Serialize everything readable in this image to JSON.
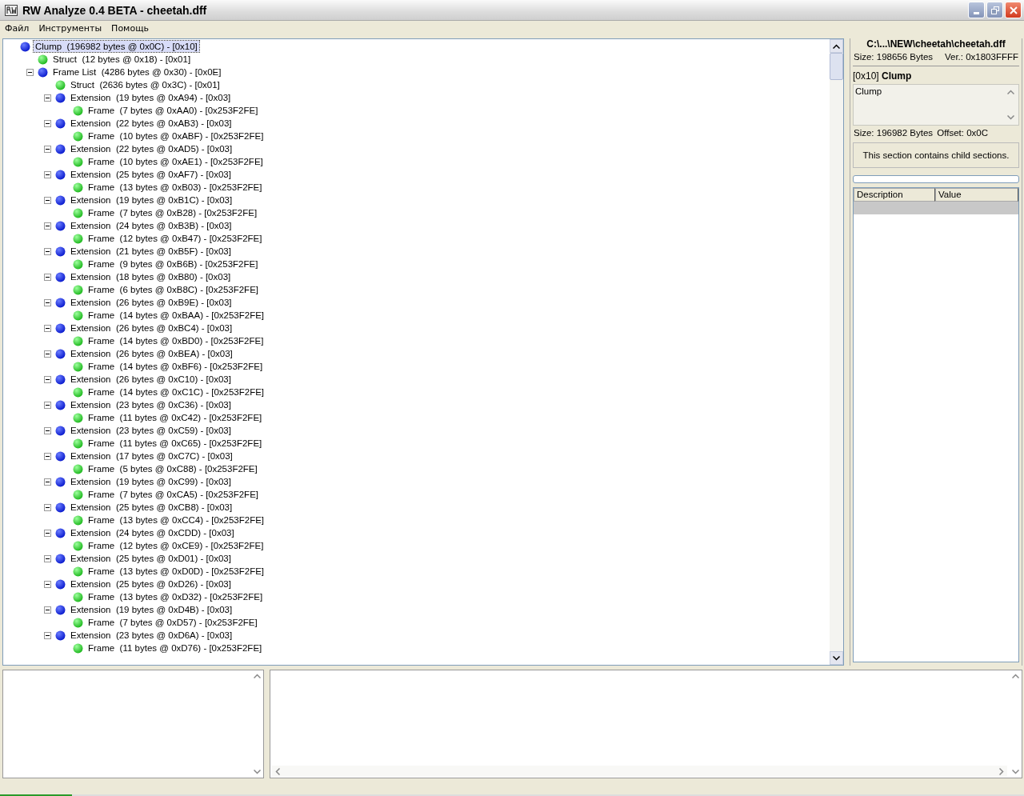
{
  "window": {
    "title": "RW Analyze 0.4 BETA - cheetah.dff"
  },
  "menu": [
    "Файл",
    "Инструменты",
    "Помощь"
  ],
  "tree": [
    {
      "label": "Clump  (196982 bytes @ 0x0C) - [0x10]",
      "kind": "container",
      "selected": true,
      "children": [
        {
          "label": "Struct  (12 bytes @ 0x18) - [0x01]",
          "kind": "data",
          "selected": false
        },
        {
          "label": "Frame List  (4286 bytes @ 0x30) - [0x0E]",
          "kind": "container",
          "selected": false,
          "expanded": true,
          "children": [
            {
              "label": "Struct  (2636 bytes @ 0x3C) - [0x01]",
              "kind": "data",
              "selected": false
            },
            {
              "label": "Extension  (19 bytes @ 0xA94) - [0x03]",
              "kind": "container",
              "selected": false,
              "expanded": true,
              "children": [
                {
                  "label": "Frame  (7 bytes @ 0xAA0) - [0x253F2FE]",
                  "kind": "data",
                  "selected": false
                }
              ]
            },
            {
              "label": "Extension  (22 bytes @ 0xAB3) - [0x03]",
              "kind": "container",
              "selected": false,
              "expanded": true,
              "children": [
                {
                  "label": "Frame  (10 bytes @ 0xABF) - [0x253F2FE]",
                  "kind": "data",
                  "selected": false
                }
              ]
            },
            {
              "label": "Extension  (22 bytes @ 0xAD5) - [0x03]",
              "kind": "container",
              "selected": false,
              "expanded": true,
              "children": [
                {
                  "label": "Frame  (10 bytes @ 0xAE1) - [0x253F2FE]",
                  "kind": "data",
                  "selected": false
                }
              ]
            },
            {
              "label": "Extension  (25 bytes @ 0xAF7) - [0x03]",
              "kind": "container",
              "selected": false,
              "expanded": true,
              "children": [
                {
                  "label": "Frame  (13 bytes @ 0xB03) - [0x253F2FE]",
                  "kind": "data",
                  "selected": false
                }
              ]
            },
            {
              "label": "Extension  (19 bytes @ 0xB1C) - [0x03]",
              "kind": "container",
              "selected": false,
              "expanded": true,
              "children": [
                {
                  "label": "Frame  (7 bytes @ 0xB28) - [0x253F2FE]",
                  "kind": "data",
                  "selected": false
                }
              ]
            },
            {
              "label": "Extension  (24 bytes @ 0xB3B) - [0x03]",
              "kind": "container",
              "selected": false,
              "expanded": true,
              "children": [
                {
                  "label": "Frame  (12 bytes @ 0xB47) - [0x253F2FE]",
                  "kind": "data",
                  "selected": false
                }
              ]
            },
            {
              "label": "Extension  (21 bytes @ 0xB5F) - [0x03]",
              "kind": "container",
              "selected": false,
              "expanded": true,
              "children": [
                {
                  "label": "Frame  (9 bytes @ 0xB6B) - [0x253F2FE]",
                  "kind": "data",
                  "selected": false
                }
              ]
            },
            {
              "label": "Extension  (18 bytes @ 0xB80) - [0x03]",
              "kind": "container",
              "selected": false,
              "expanded": true,
              "children": [
                {
                  "label": "Frame  (6 bytes @ 0xB8C) - [0x253F2FE]",
                  "kind": "data",
                  "selected": false
                }
              ]
            },
            {
              "label": "Extension  (26 bytes @ 0xB9E) - [0x03]",
              "kind": "container",
              "selected": false,
              "expanded": true,
              "children": [
                {
                  "label": "Frame  (14 bytes @ 0xBAA) - [0x253F2FE]",
                  "kind": "data",
                  "selected": false
                }
              ]
            },
            {
              "label": "Extension  (26 bytes @ 0xBC4) - [0x03]",
              "kind": "container",
              "selected": false,
              "expanded": true,
              "children": [
                {
                  "label": "Frame  (14 bytes @ 0xBD0) - [0x253F2FE]",
                  "kind": "data",
                  "selected": false
                }
              ]
            },
            {
              "label": "Extension  (26 bytes @ 0xBEA) - [0x03]",
              "kind": "container",
              "selected": false,
              "expanded": true,
              "children": [
                {
                  "label": "Frame  (14 bytes @ 0xBF6) - [0x253F2FE]",
                  "kind": "data",
                  "selected": false
                }
              ]
            },
            {
              "label": "Extension  (26 bytes @ 0xC10) - [0x03]",
              "kind": "container",
              "selected": false,
              "expanded": true,
              "children": [
                {
                  "label": "Frame  (14 bytes @ 0xC1C) - [0x253F2FE]",
                  "kind": "data",
                  "selected": false
                }
              ]
            },
            {
              "label": "Extension  (23 bytes @ 0xC36) - [0x03]",
              "kind": "container",
              "selected": false,
              "expanded": true,
              "children": [
                {
                  "label": "Frame  (11 bytes @ 0xC42) - [0x253F2FE]",
                  "kind": "data",
                  "selected": false
                }
              ]
            },
            {
              "label": "Extension  (23 bytes @ 0xC59) - [0x03]",
              "kind": "container",
              "selected": false,
              "expanded": true,
              "children": [
                {
                  "label": "Frame  (11 bytes @ 0xC65) - [0x253F2FE]",
                  "kind": "data",
                  "selected": false
                }
              ]
            },
            {
              "label": "Extension  (17 bytes @ 0xC7C) - [0x03]",
              "kind": "container",
              "selected": false,
              "expanded": true,
              "children": [
                {
                  "label": "Frame  (5 bytes @ 0xC88) - [0x253F2FE]",
                  "kind": "data",
                  "selected": false
                }
              ]
            },
            {
              "label": "Extension  (19 bytes @ 0xC99) - [0x03]",
              "kind": "container",
              "selected": false,
              "expanded": true,
              "children": [
                {
                  "label": "Frame  (7 bytes @ 0xCA5) - [0x253F2FE]",
                  "kind": "data",
                  "selected": false
                }
              ]
            },
            {
              "label": "Extension  (25 bytes @ 0xCB8) - [0x03]",
              "kind": "container",
              "selected": false,
              "expanded": true,
              "children": [
                {
                  "label": "Frame  (13 bytes @ 0xCC4) - [0x253F2FE]",
                  "kind": "data",
                  "selected": false
                }
              ]
            },
            {
              "label": "Extension  (24 bytes @ 0xCDD) - [0x03]",
              "kind": "container",
              "selected": false,
              "expanded": true,
              "children": [
                {
                  "label": "Frame  (12 bytes @ 0xCE9) - [0x253F2FE]",
                  "kind": "data",
                  "selected": false
                }
              ]
            },
            {
              "label": "Extension  (25 bytes @ 0xD01) - [0x03]",
              "kind": "container",
              "selected": false,
              "expanded": true,
              "children": [
                {
                  "label": "Frame  (13 bytes @ 0xD0D) - [0x253F2FE]",
                  "kind": "data",
                  "selected": false
                }
              ]
            },
            {
              "label": "Extension  (25 bytes @ 0xD26) - [0x03]",
              "kind": "container",
              "selected": false,
              "expanded": true,
              "children": [
                {
                  "label": "Frame  (13 bytes @ 0xD32) - [0x253F2FE]",
                  "kind": "data",
                  "selected": false
                }
              ]
            },
            {
              "label": "Extension  (19 bytes @ 0xD4B) - [0x03]",
              "kind": "container",
              "selected": false,
              "expanded": true,
              "children": [
                {
                  "label": "Frame  (7 bytes @ 0xD57) - [0x253F2FE]",
                  "kind": "data",
                  "selected": false
                }
              ]
            },
            {
              "label": "Extension  (23 bytes @ 0xD6A) - [0x03]",
              "kind": "container",
              "selected": false,
              "expanded": true,
              "children": [
                {
                  "label": "Frame  (11 bytes @ 0xD76) - [0x253F2FE]",
                  "kind": "data",
                  "selected": false
                }
              ]
            }
          ]
        }
      ]
    }
  ],
  "info": {
    "file_path": "C:\\...\\NEW\\cheetah\\cheetah.dff",
    "file_size": "Size: 198656 Bytes",
    "version": "Ver.: 0x1803FFFF",
    "section_title": "[0x10] **Clump**",
    "description": "Clump",
    "section_size": "Size: 196982 Bytes",
    "offset": "Offset: 0x0C",
    "note": "This section contains child sections.",
    "table": {
      "columns": [
        "Description",
        "Value"
      ],
      "rows": [
        {
          "selected": true
        }
      ]
    }
  },
  "status_bar": {
    "level": 0.07
  }
}
